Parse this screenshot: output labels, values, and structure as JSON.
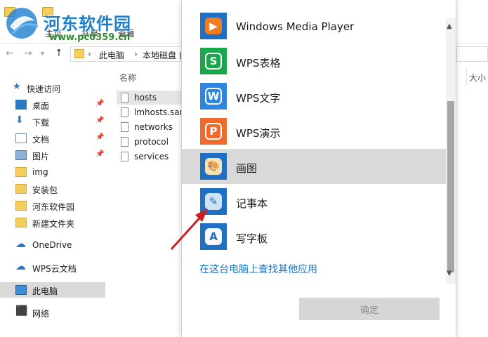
{
  "ribbon": {
    "tabs": [
      "主页",
      "共享",
      "查看"
    ]
  },
  "watermark": {
    "title": "河东软件园",
    "url": "www.pc0359.cn"
  },
  "address": {
    "crumbs": [
      "此电脑",
      "本地磁盘 ("
    ]
  },
  "nav_items": [
    {
      "label": "快速访问",
      "icon": "star-icon",
      "pinned": false
    },
    {
      "label": "桌面",
      "icon": "desktop-icon",
      "pinned": true
    },
    {
      "label": "下载",
      "icon": "download-icon",
      "pinned": true
    },
    {
      "label": "文档",
      "icon": "documents-icon",
      "pinned": true
    },
    {
      "label": "图片",
      "icon": "pictures-icon",
      "pinned": true
    },
    {
      "label": "img",
      "icon": "folder-icon",
      "pinned": false
    },
    {
      "label": "安装包",
      "icon": "folder-icon",
      "pinned": false
    },
    {
      "label": "河东软件园",
      "icon": "folder-icon",
      "pinned": false
    },
    {
      "label": "新建文件夹",
      "icon": "folder-icon",
      "pinned": false
    },
    {
      "label": "OneDrive",
      "icon": "onedrive-icon",
      "pinned": false
    },
    {
      "label": "WPS云文档",
      "icon": "wps-cloud-icon",
      "pinned": false
    },
    {
      "label": "此电脑",
      "icon": "this-pc-icon",
      "pinned": false,
      "selected": true
    },
    {
      "label": "网络",
      "icon": "network-icon",
      "pinned": false
    }
  ],
  "file_list": {
    "column_name": "名称",
    "column_size": "大小",
    "files": [
      "hosts",
      "lmhosts.sam",
      "networks",
      "protocol",
      "services"
    ]
  },
  "dialog": {
    "apps": [
      {
        "name": "Windows Media Player",
        "icon": "windows-media-player-icon",
        "color": "#1f6fc5",
        "glyph": "▶"
      },
      {
        "name": "WPS表格",
        "icon": "wps-spreadsheet-icon",
        "color": "#19a84b",
        "glyph": "S"
      },
      {
        "name": "WPS文字",
        "icon": "wps-writer-icon",
        "color": "#2e86de",
        "glyph": "W"
      },
      {
        "name": "WPS演示",
        "icon": "wps-presentation-icon",
        "color": "#f06a2c",
        "glyph": "P"
      },
      {
        "name": "画图",
        "icon": "paint-icon",
        "color": "#1f6fc5",
        "glyph": "🎨"
      },
      {
        "name": "记事本",
        "icon": "notepad-icon",
        "color": "#1f6fc5",
        "glyph": "✎"
      },
      {
        "name": "写字板",
        "icon": "wordpad-icon",
        "color": "#1f6fc5",
        "glyph": "A"
      }
    ],
    "selected_app": "画图",
    "more_apps_link": "在这台电脑上查找其他应用",
    "ok_button": "确定"
  },
  "colors": {
    "accent": "#1a73c8",
    "selection": "#d9d9d9",
    "annotation_arrow": "#cc1f1f"
  }
}
